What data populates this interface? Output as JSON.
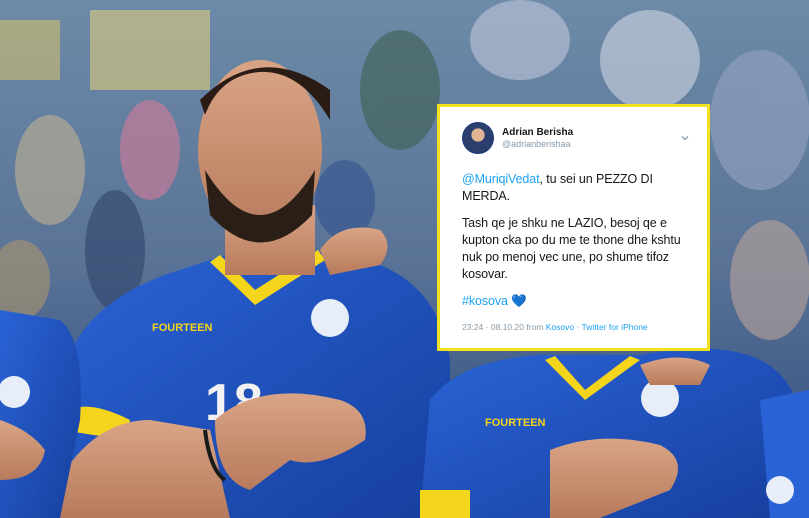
{
  "photo": {
    "jersey_brand_left": "FOURTEEN",
    "jersey_brand_right": "FOURTEEN",
    "jersey_number": "18"
  },
  "tweet": {
    "display_name": "Adrian Berisha",
    "handle": "@adrianberishaa",
    "mention": "@MuriqiVedat",
    "line1_rest": ", tu sei un PEZZO DI MERDA.",
    "paragraph2": "Tash qe je shku ne LAZIO, besoj qe e kupton cka po du me te thone dhe kshtu nuk po menoj vec une, po shume tifoz kosovar.",
    "hashtag": "#kosova",
    "emoji": "💙",
    "time": "23:24",
    "date": "08.10.20",
    "from_label": "from",
    "location": "Kosovo",
    "separator": "·",
    "source": "Twitter for iPhone"
  },
  "colors": {
    "tweet_border": "#f2e21d",
    "link_blue": "#1da1f2",
    "jersey_blue": "#1f4fbf",
    "jersey_yellow": "#f5d41c"
  }
}
